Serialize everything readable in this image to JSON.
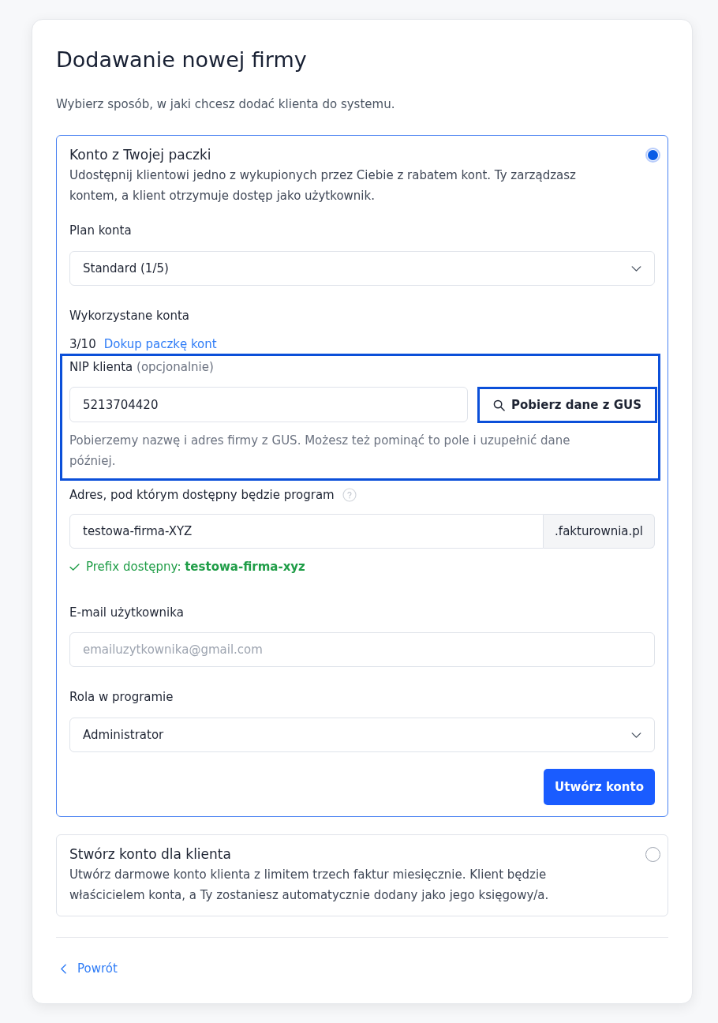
{
  "page": {
    "title": "Dodawanie nowej firmy",
    "subtitle": "Wybierz sposób, w jaki chcesz dodać klienta do systemu."
  },
  "options": [
    {
      "title": "Konto z Twojej paczki",
      "description": "Udostępnij klientowi jedno z wykupionych przez Ciebie z rabatem kont. Ty zarządzasz kontem, a klient otrzymuje dostęp jako użytkownik.",
      "selected": true,
      "fields": [
        {
          "kind": "select",
          "label": "Plan konta",
          "value": "Standard (1/5)"
        },
        {
          "kind": "usage",
          "label": "Wykorzystane konta",
          "count": "3/10",
          "link": "Dokup paczkę kont"
        },
        {
          "kind": "lookup",
          "label": "NIP klienta",
          "label_note": "(opcjonalnie)",
          "value": "5213704420",
          "button": {
            "label": "Pobierz dane z GUS",
            "highlighted": true
          },
          "help": "Pobierzemy nazwę i adres firmy z GUS. Możesz też pominąć to pole i uzupełnić dane później.",
          "highlighted": true
        },
        {
          "kind": "address",
          "label": "Adres, pod którym dostępny będzie program",
          "value": "testowa-firma-XYZ",
          "suffix": ".fakturownia.pl",
          "status": {
            "text": "Prefix dostępny:",
            "value": "testowa-firma-xyz"
          }
        },
        {
          "kind": "text",
          "label": "E-mail użytkownika",
          "placeholder": "emailuzytkownika@gmail.com"
        },
        {
          "kind": "select",
          "label": "Rola w programie",
          "value": "Administrator"
        }
      ],
      "submit": "Utwórz konto"
    },
    {
      "title": "Stwórz konto dla klienta",
      "description": "Utwórz darmowe konto klienta z limitem trzech faktur miesięcznie. Klient będzie właścicielem konta, a Ty zostaniesz automatycznie dodany jako jego księgowy/a.",
      "selected": false
    }
  ],
  "back_link": "Powrót"
}
